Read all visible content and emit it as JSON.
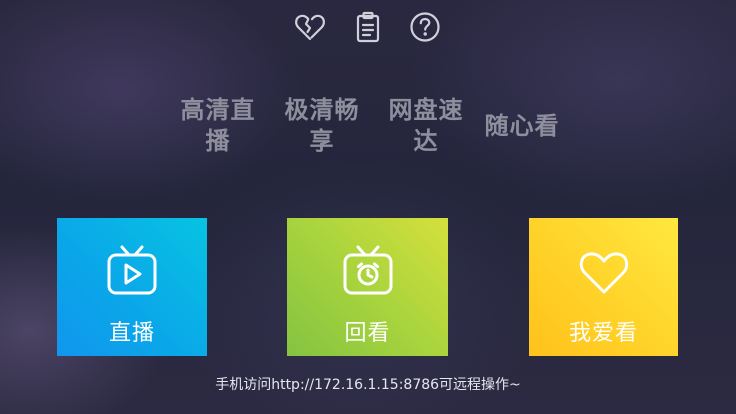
{
  "top_bar": {
    "icons": [
      "heart-outline-icon",
      "clipboard-list-icon",
      "question-circle-icon"
    ]
  },
  "slogans": [
    "高清直播",
    "极清畅享",
    "网盘速达",
    "随心看"
  ],
  "tiles": [
    {
      "label": "直播",
      "icon": "tv-play-icon",
      "color": "#0aa8e8"
    },
    {
      "label": "回看",
      "icon": "tv-clock-icon",
      "color": "#a9d43d"
    },
    {
      "label": "我爱看",
      "icon": "heart-icon",
      "color": "#ffd42a"
    }
  ],
  "footer": {
    "hint": "手机访问http://172.16.1.15:8786可远程操作~"
  }
}
